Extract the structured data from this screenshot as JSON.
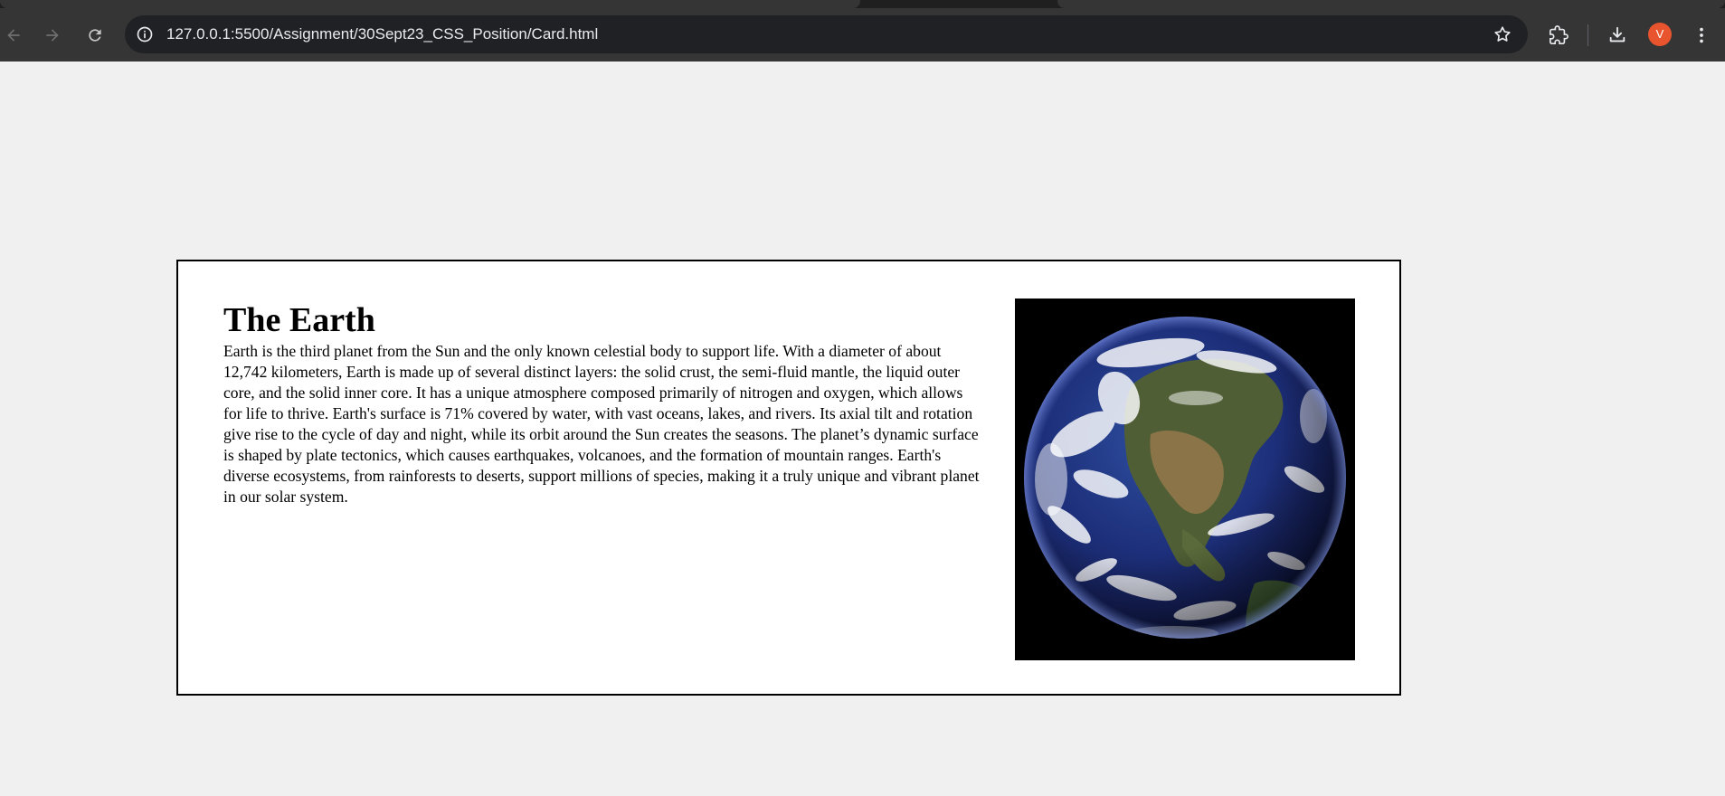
{
  "browser": {
    "address_bar": {
      "url": "127.0.0.1:5500/Assignment/30Sept23_CSS_Position/Card.html"
    },
    "profile_initial": "V",
    "icons": {
      "back": "arrow-left-icon",
      "forward": "arrow-right-icon",
      "reload": "reload-icon",
      "site_info": "info-icon",
      "bookmark": "star-icon",
      "extensions": "puzzle-icon",
      "downloads": "download-icon",
      "menu": "three-dots-vertical-icon"
    },
    "colors": {
      "toolbar": "#353535",
      "omnibox": "#202124",
      "avatar": "#e8542d"
    }
  },
  "page": {
    "background": "#f0f0f0",
    "card": {
      "title": "The Earth",
      "body": "Earth is the third planet from the Sun and the only known celestial body to support life. With a diameter of about 12,742 kilometers, Earth is made up of several distinct layers: the solid crust, the semi-fluid mantle, the liquid outer core, and the solid inner core. It has a unique atmosphere composed primarily of nitrogen and oxygen, which allows for life to thrive. Earth's surface is 71% covered by water, with vast oceans, lakes, and rivers. Its axial tilt and rotation give rise to the cycle of day and night, while its orbit around the Sun creates the seasons. The planet’s dynamic surface is shaped by plate tectonics, which causes earthquakes, volcanoes, and the formation of mountain ranges. Earth's diverse ecosystems, from rainforests to deserts, support millions of species, making it a truly unique and vibrant planet in our solar system.",
      "image": "earth-globe-image"
    }
  }
}
